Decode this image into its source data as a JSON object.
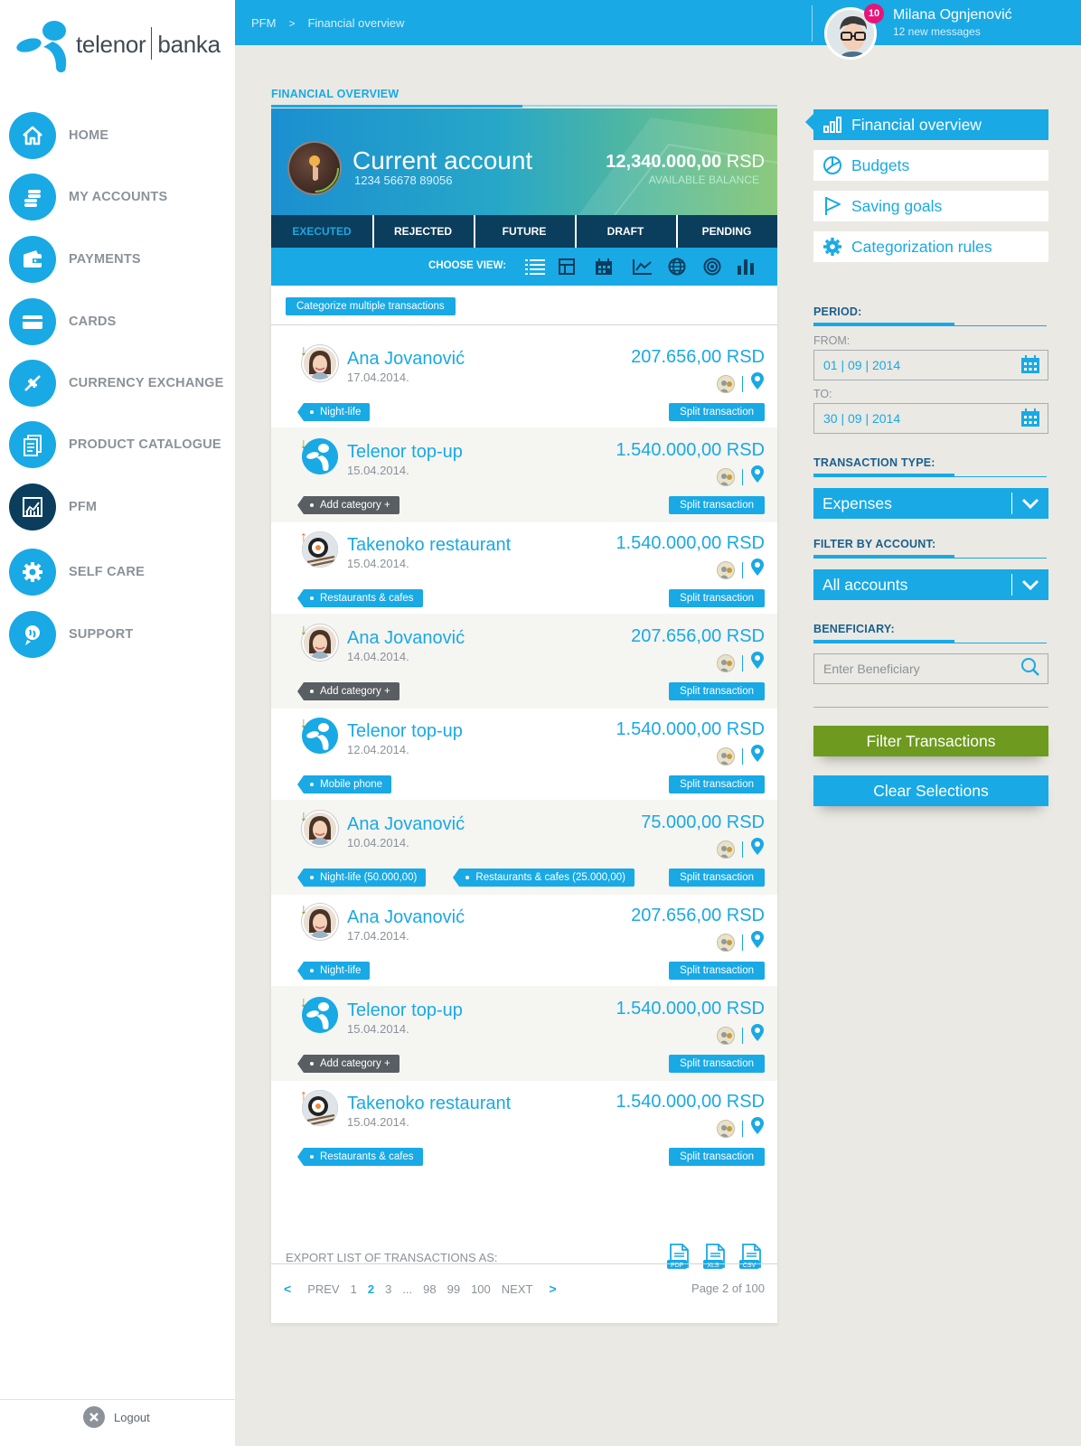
{
  "brand": {
    "logo_left": "telenor",
    "logo_right": "banka"
  },
  "nav": [
    {
      "label": "HOME",
      "icon": "home-icon"
    },
    {
      "label": "MY ACCOUNTS",
      "icon": "coins-icon"
    },
    {
      "label": "PAYMENTS",
      "icon": "wallet-icon"
    },
    {
      "label": "CARDS",
      "icon": "card-icon"
    },
    {
      "label": "CURRENCY EXCHANGE",
      "icon": "exchange-icon"
    },
    {
      "label": "PRODUCT CATALOGUE",
      "icon": "catalogue-icon"
    },
    {
      "label": "PFM",
      "icon": "chart-icon",
      "active": true
    },
    {
      "label": "SELF CARE",
      "icon": "gear-icon"
    },
    {
      "label": "SUPPORT",
      "icon": "support-icon"
    }
  ],
  "logout": "Logout",
  "breadcrumb": [
    "PFM",
    "Financial overview"
  ],
  "user": {
    "name": "Milana Ognjenović",
    "messages": "12 new messages",
    "badge": "10"
  },
  "section_title": "FINANCIAL OVERVIEW",
  "account": {
    "name": "Current account",
    "number": "1234 56678 89056",
    "balance": "12,340.000,00",
    "currency": "RSD",
    "balance_label": "AVAILABLE BALANCE"
  },
  "tabs": [
    "EXECUTED",
    "REJECTED",
    "FUTURE",
    "DRAFT",
    "PENDING"
  ],
  "active_tab": "EXECUTED",
  "choose_view": "CHOOSE VIEW:",
  "view_icons": [
    "list-icon",
    "grid-icon",
    "calendar-icon",
    "line-chart-icon",
    "globe-icon",
    "target-icon",
    "bar-chart-icon"
  ],
  "categorize_button": "Categorize multiple transactions",
  "split_label": "Split transaction",
  "transactions": [
    {
      "name": "Ana Jovanović",
      "date": "17.04.2014.",
      "amount": "207.656,00 RSD",
      "direction": "in",
      "avatar": "person",
      "tags": [
        {
          "label": "Night-life",
          "dark": false
        }
      ]
    },
    {
      "name": "Telenor top-up",
      "date": "15.04.2014.",
      "amount": "1.540.000,00 RSD",
      "direction": "in",
      "avatar": "tel",
      "tags": [
        {
          "label": "Add category +",
          "dark": true
        }
      ]
    },
    {
      "name": "Takenoko restaurant",
      "date": "15.04.2014.",
      "amount": "1.540.000,00 RSD",
      "direction": "out",
      "avatar": "food",
      "tags": [
        {
          "label": "Restaurants & cafes",
          "dark": false
        }
      ]
    },
    {
      "name": "Ana Jovanović",
      "date": "14.04.2014.",
      "amount": "207.656,00 RSD",
      "direction": "in",
      "avatar": "person",
      "tags": [
        {
          "label": "Add category +",
          "dark": true
        }
      ]
    },
    {
      "name": "Telenor top-up",
      "date": "12.04.2014.",
      "amount": "1.540.000,00 RSD",
      "direction": "in",
      "avatar": "tel",
      "tags": [
        {
          "label": "Mobile phone",
          "dark": false
        }
      ]
    },
    {
      "name": "Ana Jovanović",
      "date": "10.04.2014.",
      "amount": "75.000,00 RSD",
      "direction": "in",
      "avatar": "person",
      "tags": [
        {
          "label": "Night-life (50.000,00)",
          "dark": false
        },
        {
          "label": "Restaurants & cafes (25.000,00)",
          "dark": false
        }
      ]
    },
    {
      "name": "Ana Jovanović",
      "date": "17.04.2014.",
      "amount": "207.656,00 RSD",
      "direction": "in",
      "avatar": "person",
      "tags": [
        {
          "label": "Night-life",
          "dark": false
        }
      ]
    },
    {
      "name": "Telenor top-up",
      "date": "15.04.2014.",
      "amount": "1.540.000,00 RSD",
      "direction": "in",
      "avatar": "tel",
      "tags": [
        {
          "label": "Add category +",
          "dark": true
        }
      ]
    },
    {
      "name": "Takenoko restaurant",
      "date": "15.04.2014.",
      "amount": "1.540.000,00 RSD",
      "direction": "out",
      "avatar": "food",
      "tags": [
        {
          "label": "Restaurants & cafes",
          "dark": false
        }
      ]
    }
  ],
  "export": {
    "label": "EXPORT LIST OF TRANSACTIONS AS:",
    "formats": [
      "PDF",
      "XLS",
      "CSV"
    ]
  },
  "pagination": {
    "prev": "PREV",
    "next": "NEXT",
    "pages": [
      "1",
      "2",
      "3",
      "...",
      "98",
      "99",
      "100"
    ],
    "current": "2",
    "info": "Page 2 of 100"
  },
  "right_menu": [
    {
      "label": "Financial overview",
      "icon": "bars-icon",
      "active": true
    },
    {
      "label": "Budgets",
      "icon": "pie-icon"
    },
    {
      "label": "Saving goals",
      "icon": "flag-icon"
    },
    {
      "label": "Categorization rules",
      "icon": "gear-icon"
    }
  ],
  "filters": {
    "period": "PERIOD:",
    "from_label": "FROM:",
    "from_value": "01 | 09 | 2014",
    "to_label": "TO:",
    "to_value": "30 | 09 | 2014",
    "type_label": "TRANSACTION TYPE:",
    "type_value": "Expenses",
    "account_label": "FILTER BY ACCOUNT:",
    "account_value": "All accounts",
    "beneficiary_label": "BENEFICIARY:",
    "beneficiary_placeholder": "Enter Beneficiary",
    "filter_button": "Filter Transactions",
    "clear_button": "Clear Selections"
  },
  "colors": {
    "accent": "#19a9e5",
    "dark": "#0b3d5c",
    "green": "#6e9a1f",
    "badge": "#e6157a",
    "in": "#6f9a1a",
    "out": "#ef6b1f"
  }
}
